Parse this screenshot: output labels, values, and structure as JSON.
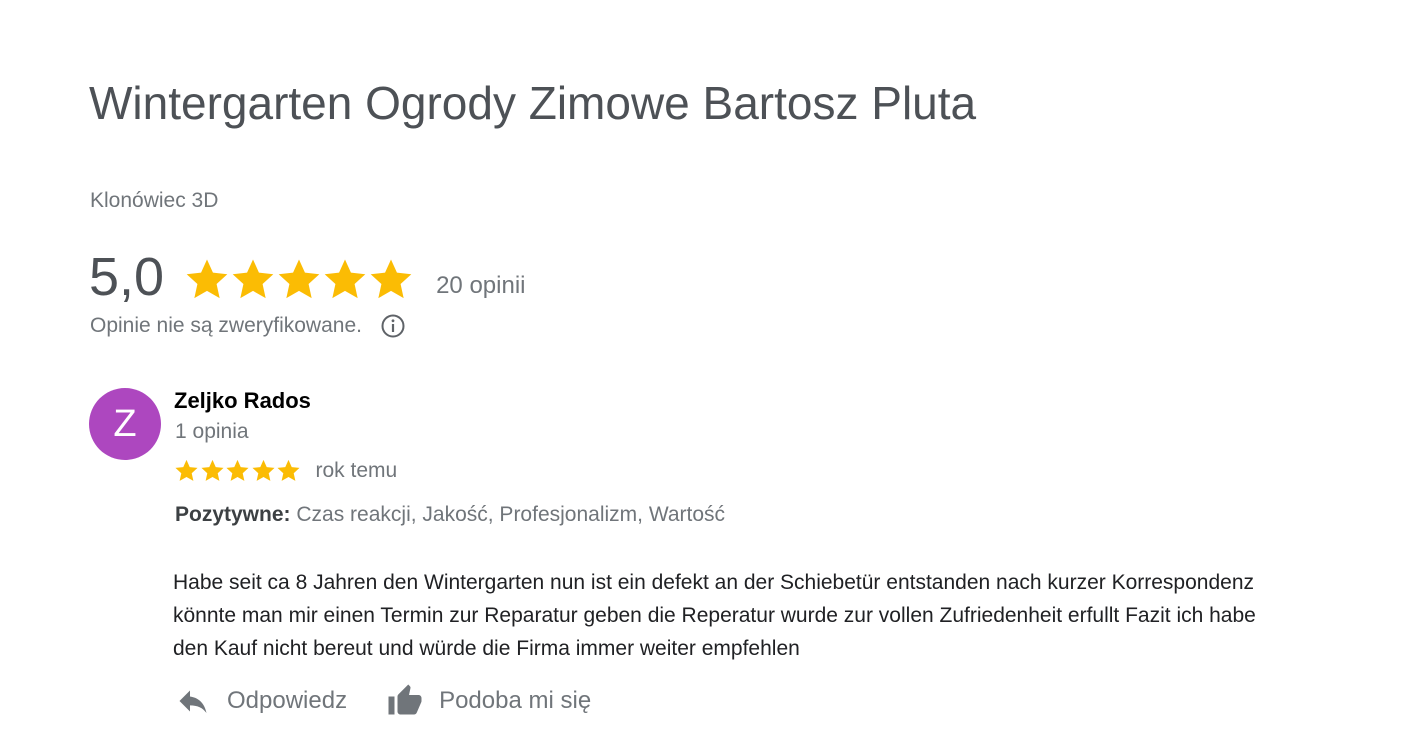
{
  "business": {
    "name": "Wintergarten Ogrody Zimowe Bartosz Pluta",
    "location": "Klonówiec 3D"
  },
  "rating": {
    "value": "5,0",
    "stars": 5,
    "count_label": "20 opinii",
    "verify_note": "Opinie nie są zweryfikowane.",
    "star_color": "#fbbc04"
  },
  "review": {
    "avatar_letter": "Z",
    "avatar_color": "#ad47bf",
    "author": "Zeljko Rados",
    "author_reviews": "1 opinia",
    "stars": 5,
    "time": "rok temu",
    "positives_label": "Pozytywne:",
    "positives_values": "Czas reakcji, Jakość, Profesjonalizm, Wartość",
    "text": "Habe seit ca 8 Jahren den Wintergarten nun ist ein defekt an der Schiebetür entstanden nach kurzer Korrespondenz könnte man mir einen Termin zur Reparatur geben die Reperatur wurde zur vollen Zufriedenheit erfullt Fazit ich habe den Kauf nicht bereut und würde die Firma immer weiter empfehlen"
  },
  "actions": {
    "reply_label": "Odpowiedz",
    "reply_icon": "reply-arrow-icon",
    "like_label": "Podoba mi się",
    "like_icon": "thumbs-up-icon"
  }
}
